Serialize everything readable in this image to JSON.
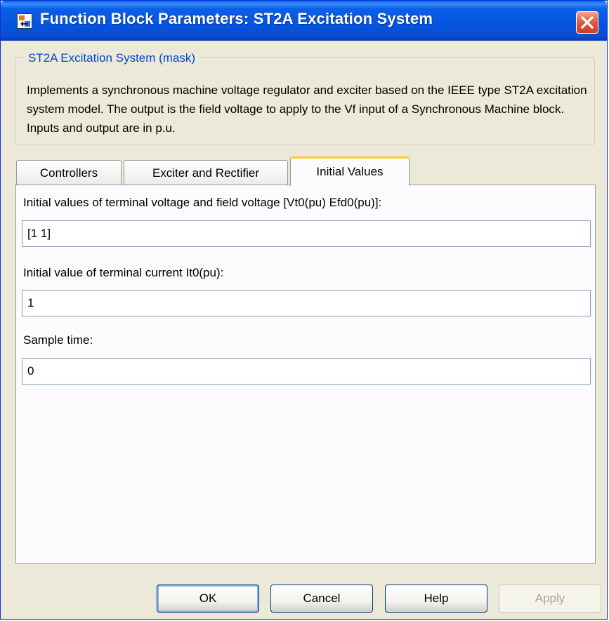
{
  "window": {
    "title": "Function Block Parameters: ST2A Excitation System",
    "colors": {
      "titlebar": "#0554e0",
      "face": "#ece9d8",
      "close": "#e2593c",
      "active_tab_accent": "#ffc83c"
    }
  },
  "mask": {
    "legend": "ST2A Excitation System (mask)",
    "description": "Implements a synchronous machine voltage regulator and exciter based on the IEEE type ST2A excitation system model. The output is the field voltage to apply to the Vf input of a Synchronous Machine block. Inputs and output are in p.u."
  },
  "tabs": [
    {
      "label": "Controllers",
      "active": false
    },
    {
      "label": "Exciter and Rectifier",
      "active": false
    },
    {
      "label": "Initial Values",
      "active": true
    }
  ],
  "params": {
    "initial_vt_efd": {
      "label": "Initial values of terminal voltage and field voltage [Vt0(pu) Efd0(pu)]:",
      "value": "[1 1]"
    },
    "initial_it": {
      "label": "Initial value of terminal current It0(pu):",
      "value": "1"
    },
    "sample_time": {
      "label": "Sample time:",
      "value": "0"
    }
  },
  "buttons": {
    "ok": "OK",
    "cancel": "Cancel",
    "help": "Help",
    "apply": "Apply"
  },
  "icons": {
    "title": "simulink-block-icon",
    "close": "close-icon"
  }
}
